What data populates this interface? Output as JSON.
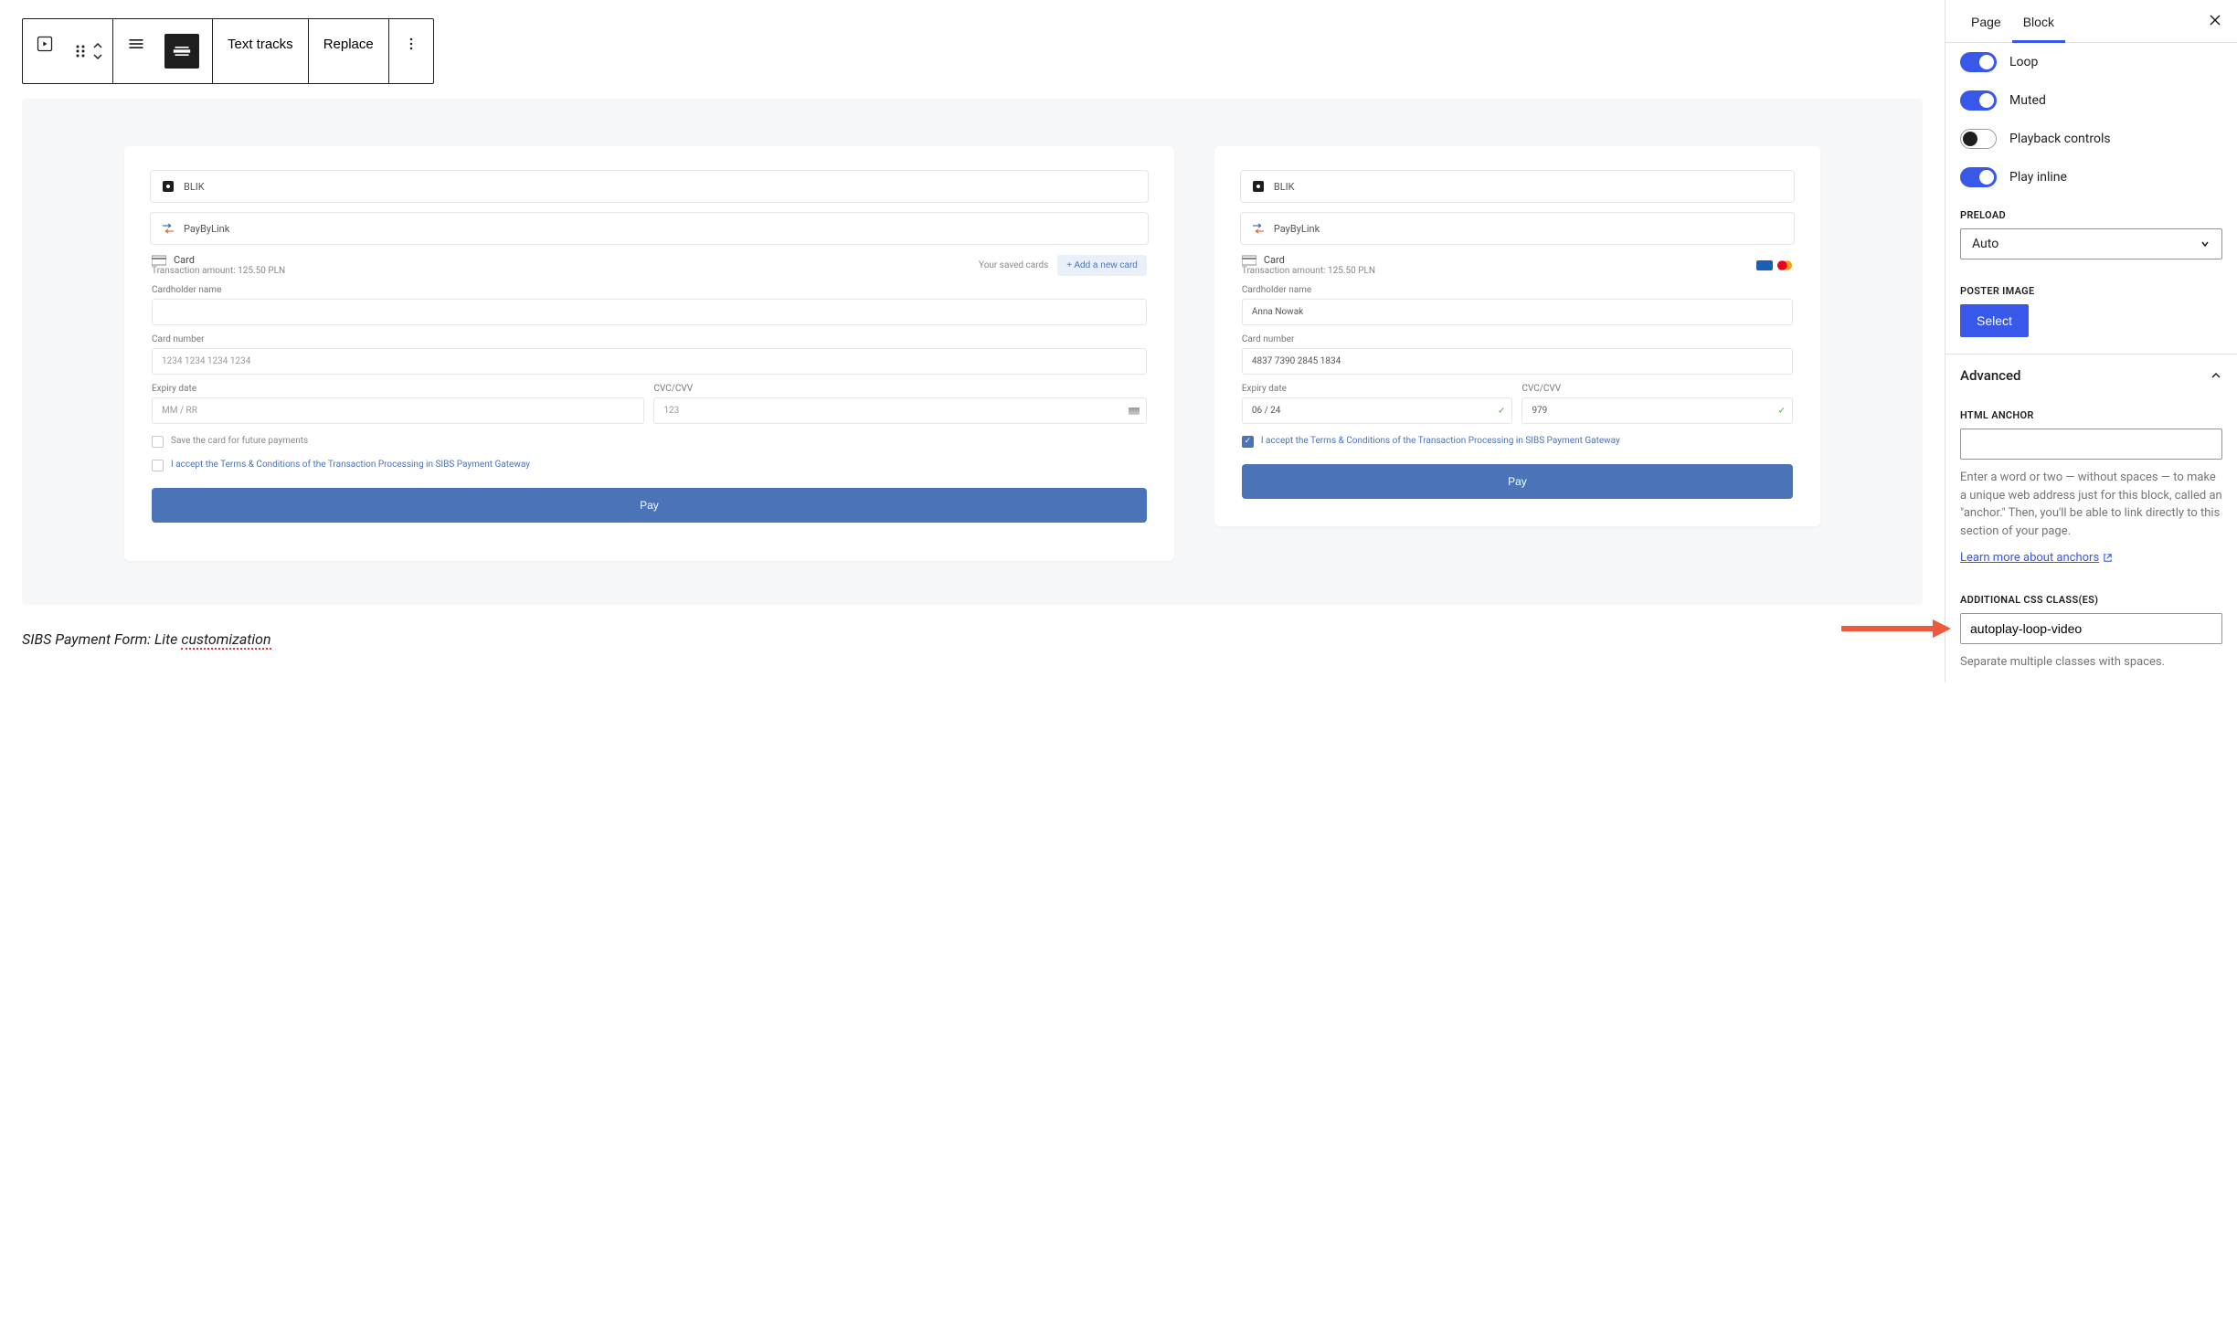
{
  "toolbar": {
    "text_tracks": "Text tracks",
    "replace": "Replace"
  },
  "preview": {
    "left": {
      "blik": "BLIK",
      "paybylink": "PayByLink",
      "card": "Card",
      "tx_amount": "Transaction amount: 125.50 PLN",
      "saved_cards": "Your saved cards",
      "add_card": "+ Add a new card",
      "cardholder_label": "Cardholder name",
      "cardnumber_label": "Card number",
      "cardnumber_placeholder": "1234 1234 1234 1234",
      "expiry_label": "Expiry date",
      "expiry_placeholder": "MM / RR",
      "cvc_label": "CVC/CVV",
      "cvc_placeholder": "123",
      "save_card": "Save the card for future payments",
      "terms": "I accept the Terms & Conditions of the Transaction Processing in SIBS Payment Gateway",
      "pay": "Pay"
    },
    "right": {
      "blik": "BLIK",
      "paybylink": "PayByLink",
      "card": "Card",
      "tx_amount": "Transaction amount: 125.50 PLN",
      "cardholder_label": "Cardholder name",
      "cardholder_value": "Anna Nowak",
      "cardnumber_label": "Card number",
      "cardnumber_value": "4837 7390 2845 1834",
      "expiry_label": "Expiry date",
      "expiry_value": "06 / 24",
      "cvc_label": "CVC/CVV",
      "cvc_value": "979",
      "terms": "I accept the Terms & Conditions of the Transaction Processing in SIBS Payment Gateway",
      "pay": "Pay"
    }
  },
  "caption": {
    "prefix": "SIBS Payment Form: Lite ",
    "underlined": "customization"
  },
  "sidebar": {
    "tabs": {
      "page": "Page",
      "block": "Block"
    },
    "toggles": {
      "loop": "Loop",
      "muted": "Muted",
      "playback": "Playback controls",
      "inline": "Play inline"
    },
    "preload": {
      "label": "PRELOAD",
      "value": "Auto"
    },
    "poster": {
      "label": "POSTER IMAGE",
      "button": "Select"
    },
    "advanced": {
      "title": "Advanced",
      "anchor_label": "HTML ANCHOR",
      "anchor_help": "Enter a word or two — without spaces — to make a unique web address just for this block, called an \"anchor.\" Then, you'll be able to link directly to this section of your page.",
      "anchor_link": "Learn more about anchors",
      "css_label": "ADDITIONAL CSS CLASS(ES)",
      "css_value": "autoplay-loop-video",
      "css_help": "Separate multiple classes with spaces."
    }
  }
}
